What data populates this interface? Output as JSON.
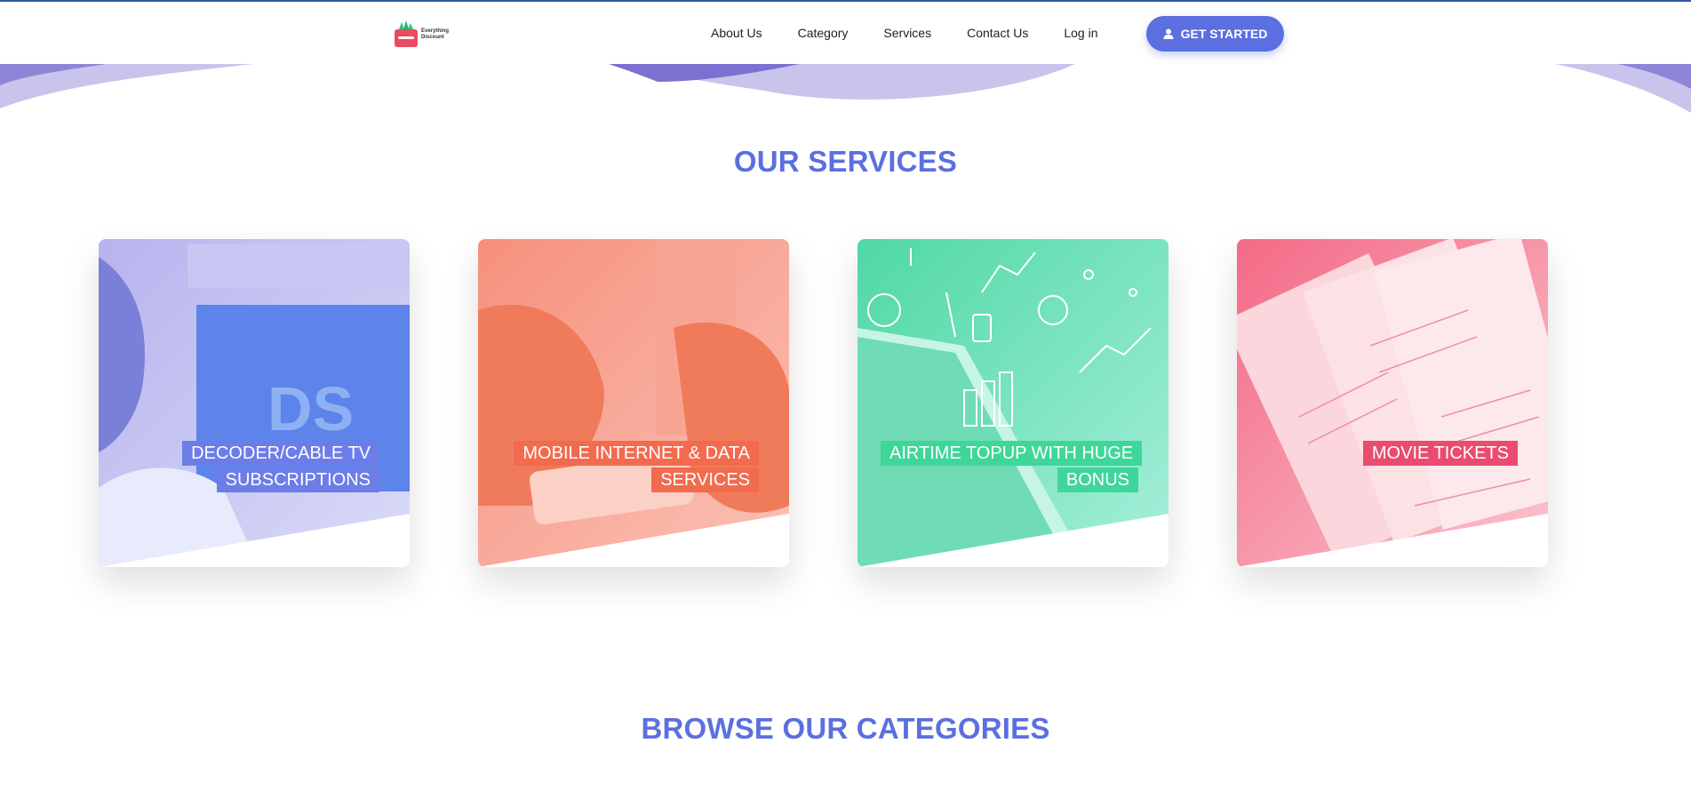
{
  "header": {
    "logo": {
      "text_line1": "Everything",
      "text_line2": "Discount"
    },
    "nav": [
      "About Us",
      "Category",
      "Services",
      "Contact Us",
      "Log in"
    ],
    "cta_label": "GET STARTED"
  },
  "services": {
    "title": "OUR SERVICES",
    "cards": [
      {
        "label": "DECODER/CABLE TV SUBSCRIPTIONS",
        "accent": "#6c7de8"
      },
      {
        "label": "MOBILE INTERNET & DATA SERVICES",
        "accent": "#f26b4e"
      },
      {
        "label": "AIRTIME TOPUP WITH HUGE BONUS",
        "accent": "#3fd69a"
      },
      {
        "label": "MOVIE TICKETS",
        "accent": "#ea4b6e"
      }
    ]
  },
  "categories": {
    "title": "BROWSE OUR CATEGORIES"
  },
  "colors": {
    "primary": "#5b6fe0",
    "top_line": "#2e5ca8"
  },
  "icons": {
    "cta": "user-icon",
    "logo": "basket-icon"
  }
}
